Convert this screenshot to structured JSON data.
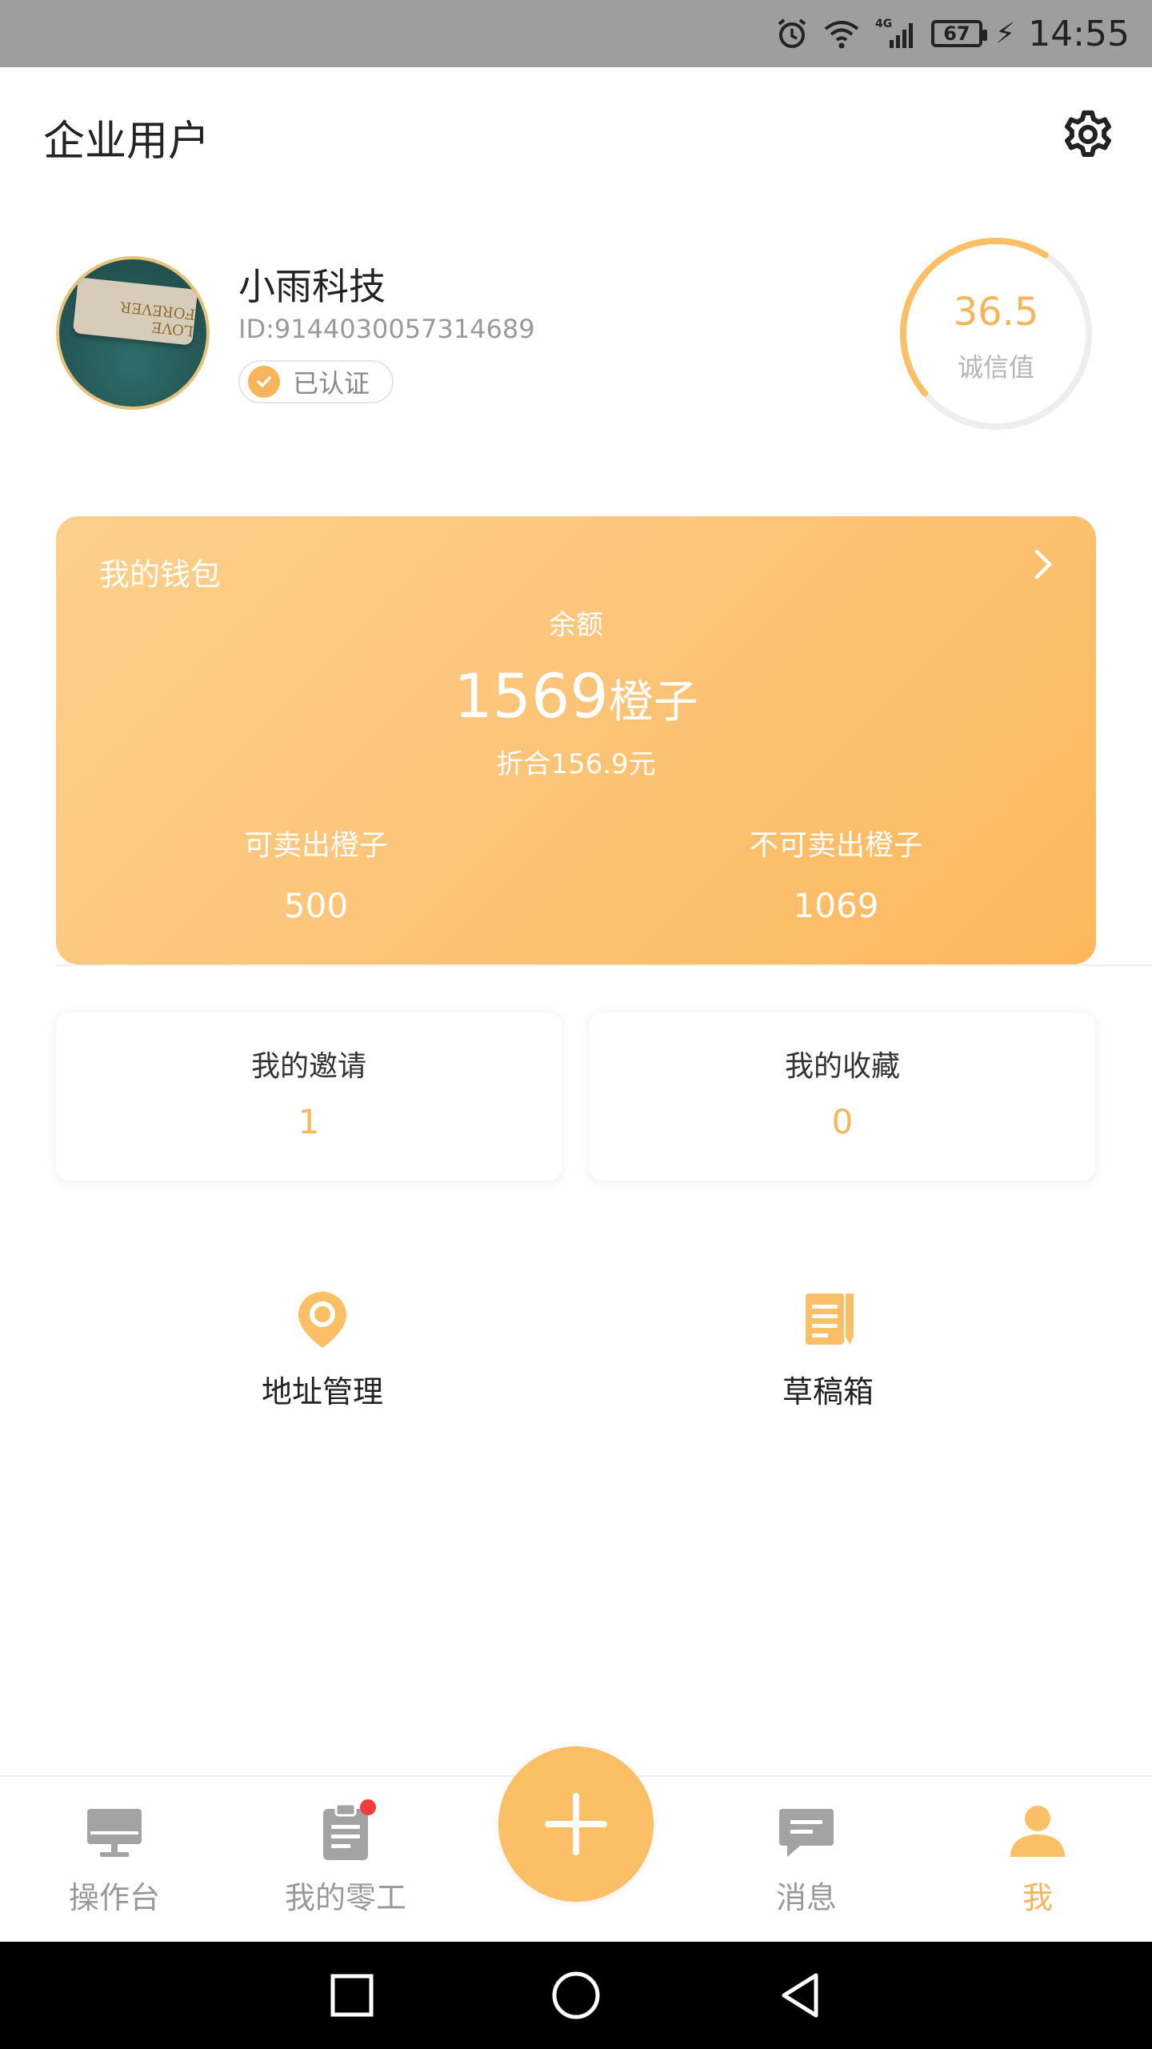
{
  "status_bar": {
    "time": "14:55",
    "battery": "67",
    "network": "4G",
    "icons": [
      "alarm-icon",
      "wifi-icon",
      "signal-icon",
      "battery-icon",
      "charging-icon"
    ]
  },
  "header": {
    "title": "企业用户",
    "settings_icon": "gear-icon"
  },
  "profile": {
    "avatar_text": "LOVE FOREVER",
    "company_name": "小雨科技",
    "id_text": "ID:9144030057314689",
    "verified_label": "已认证",
    "credit_value": "36.5",
    "credit_label": "诚信值",
    "credit_progress": 0.45
  },
  "wallet": {
    "title": "我的钱包",
    "balance_label": "余额",
    "balance_amount": "1569",
    "balance_unit": "橙子",
    "conversion": "折合156.9元",
    "sellable_label": "可卖出橙子",
    "sellable_value": "500",
    "unsellable_label": "不可卖出橙子",
    "unsellable_value": "1069"
  },
  "cards": [
    {
      "title": "我的邀请",
      "value": "1"
    },
    {
      "title": "我的收藏",
      "value": "0"
    }
  ],
  "shortcuts": [
    {
      "label": "地址管理",
      "icon": "location-pin-icon"
    },
    {
      "label": "草稿箱",
      "icon": "drafts-icon"
    }
  ],
  "bottom_nav": {
    "items": [
      {
        "label": "操作台",
        "icon": "monitor-icon"
      },
      {
        "label": "我的零工",
        "icon": "clipboard-icon"
      },
      {
        "label": "消息",
        "icon": "chat-icon"
      },
      {
        "label": "我",
        "icon": "user-icon"
      }
    ],
    "active": "我",
    "fab_icon": "plus-icon"
  },
  "colors": {
    "accent": "#f7b55b",
    "notification_dot": "#f23d3d",
    "status_bar": "#9e9e9e"
  }
}
